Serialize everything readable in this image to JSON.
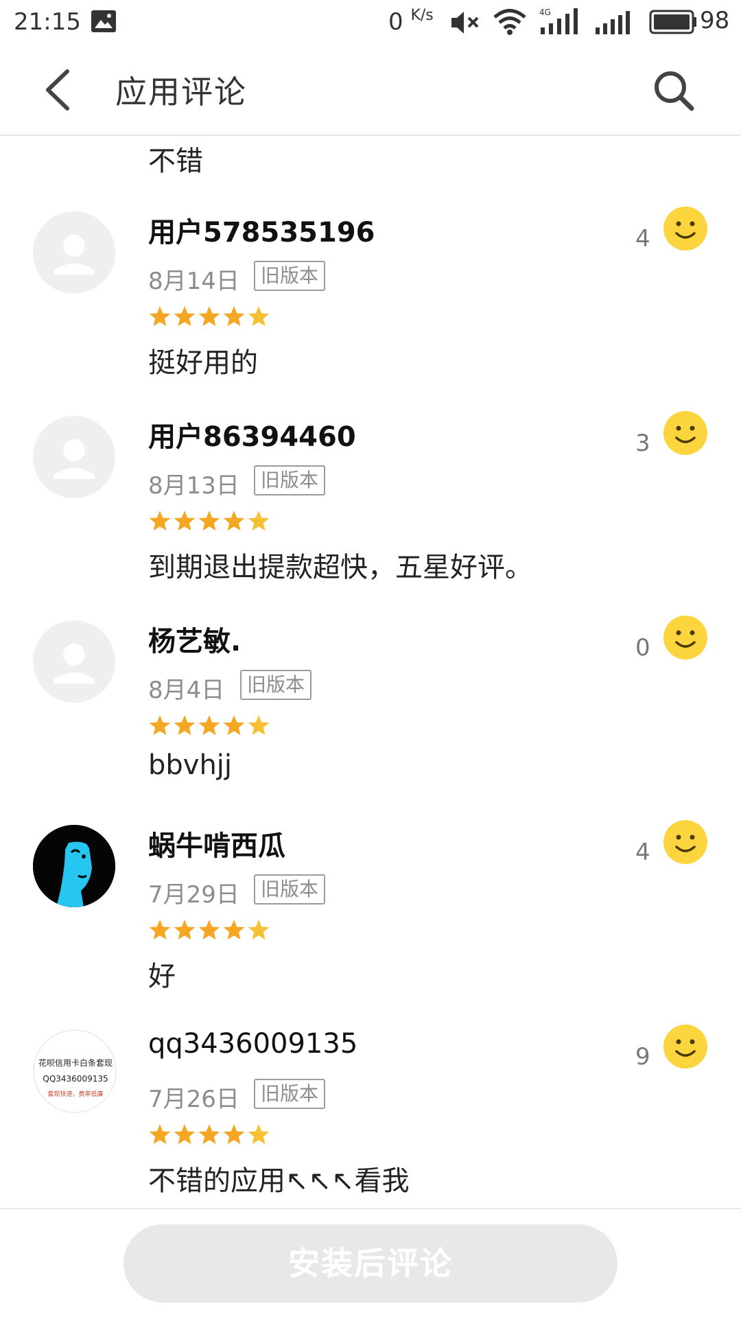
{
  "status_bar": {
    "time": "21:15",
    "speed": "0",
    "speed_unit": "K/s",
    "battery": "98",
    "icons": [
      "photo-icon",
      "mute-icon",
      "wifi-icon",
      "4g-signal-icon",
      "signal-icon",
      "battery-icon"
    ]
  },
  "header": {
    "title": "应用评论",
    "back_icon": "back-chevron-icon",
    "search_icon": "search-icon"
  },
  "partial_comment": "不错",
  "reviews": [
    {
      "user": "用户578535196",
      "date": "8月14日",
      "version": "旧版本",
      "rating": 5,
      "text": "挺好用的",
      "likes": "4",
      "avatar": "default-avatar-icon"
    },
    {
      "user": "用户86394460",
      "date": "8月13日",
      "version": "旧版本",
      "rating": 5,
      "text": "到期退出提款超快，五星好评。",
      "likes": "3",
      "avatar": "default-avatar-icon"
    },
    {
      "user": "杨艺敏.",
      "date": "8月4日",
      "version": "旧版本",
      "rating": 5,
      "text": "bbvhjj",
      "likes": "0",
      "avatar": "default-avatar-icon"
    },
    {
      "user": "蜗牛啃西瓜",
      "date": "7月29日",
      "version": "旧版本",
      "rating": 5,
      "text": "好",
      "likes": "4",
      "avatar": "photo-avatar"
    },
    {
      "user": "qq3436009135",
      "date": "7月26日",
      "version": "旧版本",
      "rating": 5,
      "text": "不错的应用↖↖↖看我",
      "likes": "9",
      "avatar": "ad-text-avatar",
      "avatar_lines": [
        "花呗信用卡白条套现",
        "QQ3436009135",
        "套现快速，费率低廉"
      ]
    }
  ],
  "footer": {
    "install_comment_label": "安装后评论"
  },
  "colors": {
    "star": "#f5a623",
    "smile": "#fcd43e",
    "accent_gray": "#8c8c8c",
    "button_bg": "#e8e8e8"
  }
}
